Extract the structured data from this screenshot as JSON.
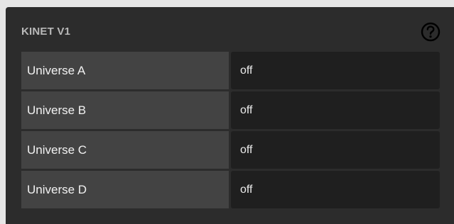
{
  "panel": {
    "title": "KINET V1",
    "help_icon": "question-circle-icon"
  },
  "universes": [
    {
      "label": "Universe A",
      "value": "off"
    },
    {
      "label": "Universe B",
      "value": "off"
    },
    {
      "label": "Universe C",
      "value": "off"
    },
    {
      "label": "Universe D",
      "value": "off"
    }
  ],
  "colors": {
    "panel_background": "#2c2c2c",
    "label_cell": "#434343",
    "value_cell": "#1f1f1f",
    "title_text": "#b9b9b9"
  }
}
